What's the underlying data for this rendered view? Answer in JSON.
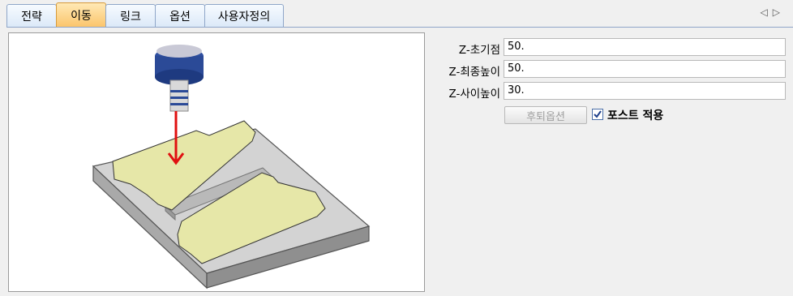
{
  "tabs": [
    "전략",
    "이동",
    "링크",
    "옵션",
    "사용자정의"
  ],
  "active_tab": "이동",
  "tab_nav": {
    "prev": "◁",
    "next": "▷"
  },
  "fields": [
    {
      "label": "Z-초기점",
      "value": "50."
    },
    {
      "label": "Z-최종높이",
      "value": "50."
    },
    {
      "label": "Z-사이높이",
      "value": "30."
    }
  ],
  "options_button": "후퇴옵션",
  "post_apply": {
    "label": "포스트 적용",
    "checked": true
  },
  "colors": {
    "tab_active": "#fbc56c",
    "tab_border": "#8fa6c8",
    "arrow": "#e01010",
    "plate": "#e6e7a8"
  }
}
